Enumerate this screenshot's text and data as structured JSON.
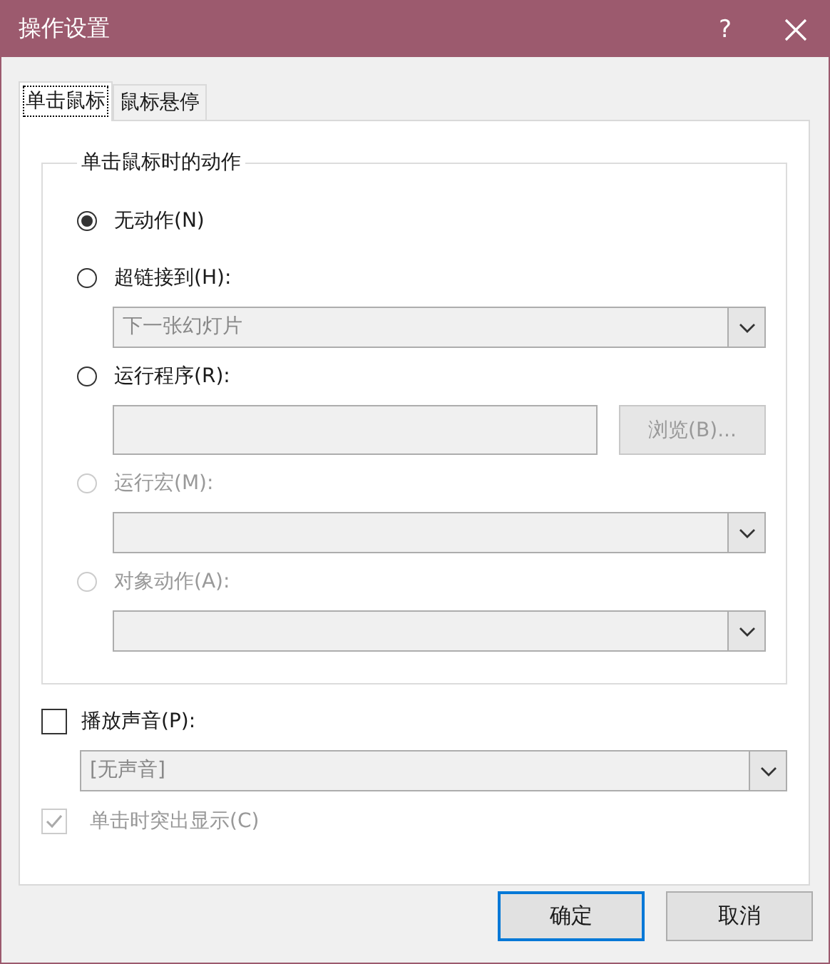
{
  "window": {
    "title": "操作设置",
    "help": "?"
  },
  "tabs": [
    {
      "label": "单击鼠标",
      "selected": true
    },
    {
      "label": "鼠标悬停",
      "selected": false
    }
  ],
  "group": {
    "legend": "单击鼠标时的动作",
    "options": [
      {
        "kind": "radio",
        "label": "无动作(N)",
        "selected": true,
        "disabled": false
      },
      {
        "kind": "radio",
        "label": "超链接到(H):",
        "selected": false,
        "disabled": false
      },
      {
        "kind": "dropdown",
        "value": "下一张幻灯片",
        "disabled": true
      },
      {
        "kind": "radio",
        "label": "运行程序(R):",
        "selected": false,
        "disabled": false
      },
      {
        "kind": "path",
        "button": "浏览(B)...",
        "disabled": true
      },
      {
        "kind": "radio",
        "label": "运行宏(M):",
        "selected": false,
        "disabled": true
      },
      {
        "kind": "dropdown",
        "disabled": true
      },
      {
        "kind": "radio",
        "label": "对象动作(A):",
        "selected": false,
        "disabled": true
      },
      {
        "kind": "dropdown",
        "disabled": true
      }
    ]
  },
  "sound": {
    "label": "播放声音(P):",
    "checked": false,
    "disabled": false,
    "dropdown": {
      "value": "[无声音]",
      "disabled": true
    }
  },
  "highlight": {
    "label": "单击时突出显示(C)",
    "checked": true,
    "disabled": true
  },
  "buttons": [
    {
      "label": "确定",
      "default": true
    },
    {
      "label": "取消",
      "default": false
    }
  ]
}
